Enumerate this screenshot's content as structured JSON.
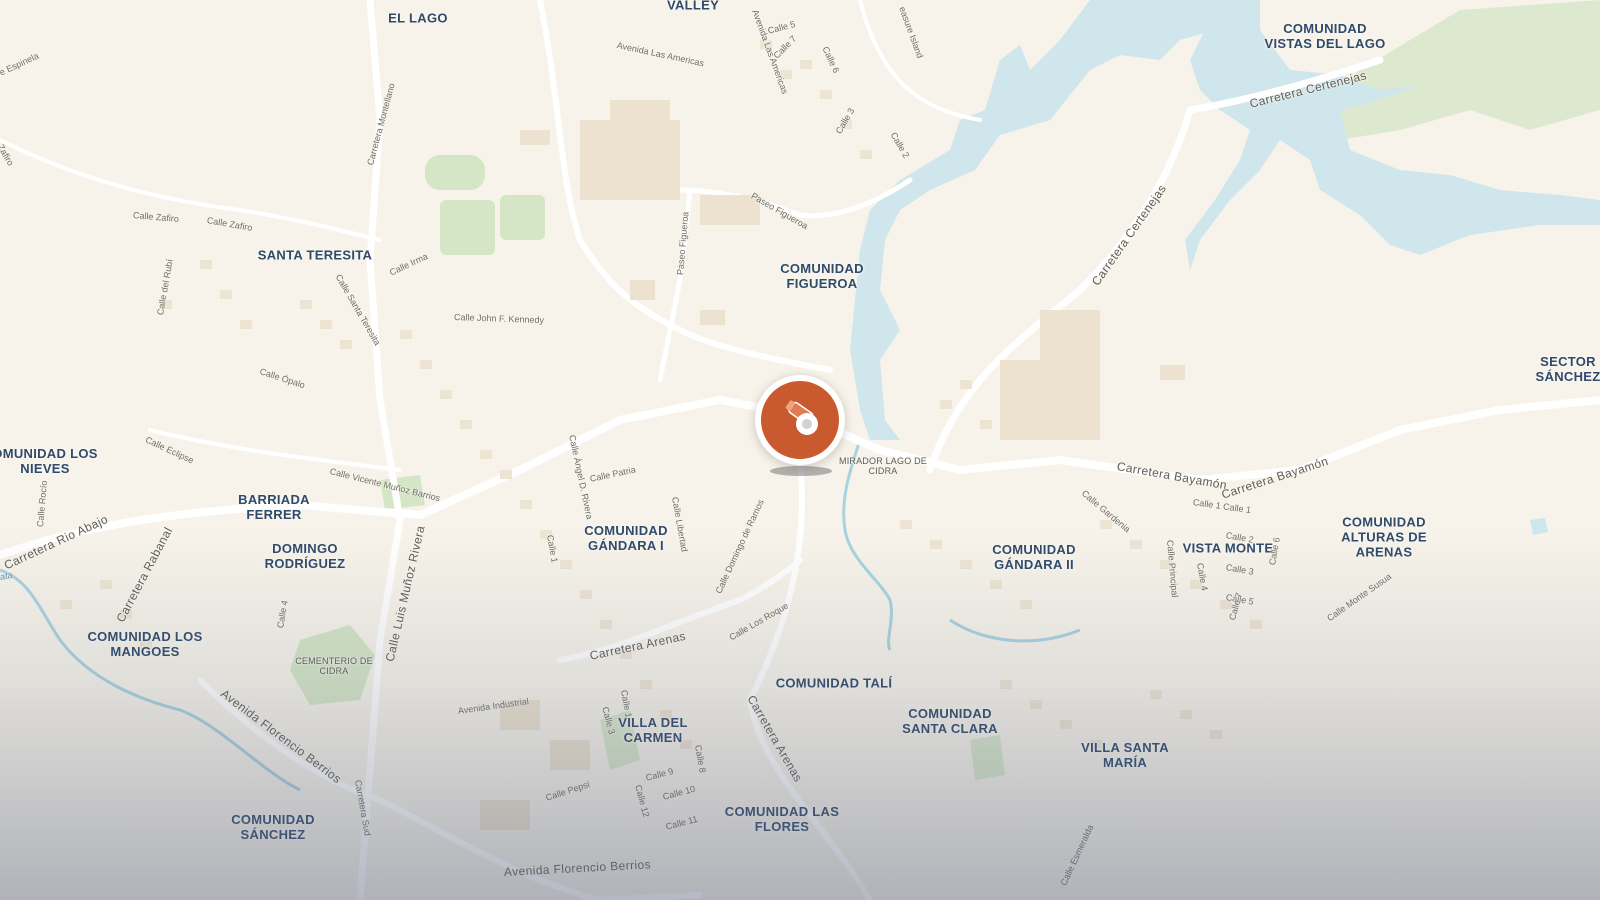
{
  "map": {
    "colors": {
      "land": "#f7f3ea",
      "water": "#cfe6ec",
      "park": "#dbe9cf",
      "road": "#ffffff",
      "building": "#ece2cf",
      "label": "#2f4a6b",
      "marker": "#c9592f"
    },
    "marker": {
      "label": "MIRADOR LAGO DE\nCIDRA",
      "icon": "telescope-icon"
    },
    "area_labels": {
      "el_lago": "EL LAGO",
      "valley": "VALLEY",
      "comunidad_vistas_del_lago": "COMUNIDAD\nVISTAS DEL LAGO",
      "santa_teresita": "SANTA TERESITA",
      "comunidad_figueroa": "COMUNIDAD\nFIGUEROA",
      "sector_sanchez": "SECTOR\nSÁNCHEZ",
      "comunidad_los_nieves": "OMUNIDAD LOS\nNIEVES",
      "barriada_ferrer": "BARRIADA\nFERRER",
      "domingo_rodriguez": "DOMINGO\nRODRÍGUEZ",
      "comunidad_gandara_i": "COMUNIDAD\nGÁNDARA I",
      "comunidad_gandara_ii": "COMUNIDAD\nGÁNDARA II",
      "vista_monte": "VISTA MONTE",
      "comunidad_alturas_de_arenas": "COMUNIDAD\nALTURAS DE\nARENAS",
      "comunidad_los_mangoes": "COMUNIDAD LOS\nMANGOES",
      "comunidad_tali": "COMUNIDAD TALÍ",
      "comunidad_santa_clara": "COMUNIDAD\nSANTA CLARA",
      "villa_del_carmen": "VILLA DEL\nCARMEN",
      "villa_santa_maria": "VILLA SANTA\nMARÍA",
      "comunidad_sanchez": "COMUNIDAD\nSÁNCHEZ",
      "comunidad_las_flores": "COMUNIDAD LAS\nFLORES"
    },
    "poi_labels": {
      "cementerio_de_cidra": "CEMENTERIO DE\nCIDRA"
    },
    "street_labels": {
      "carretera_montellano": "Carretera Montellano",
      "avenida_las_americas": "Avenida Las Americas",
      "avenida_las_americas_2": "Avenida Las Americas",
      "calle_espinela": "e Espinela",
      "zafiro": "Zafiro",
      "calle_zafiro": "Calle Zafiro",
      "calle_zafiro_2": "Calle Zafiro",
      "calle_irma": "Calle Irma",
      "calle_del_rubi": "Calle del Rubí",
      "calle_santa_teresita": "Calle Santa Teresita",
      "calle_john_f_kennedy": "Calle John F. Kennedy",
      "paseo_figueroa": "Paseo Figueroa",
      "paseo_figueroa_2": "Paseo Figueroa",
      "calle_opalo": "Calle Ópalo",
      "calle_eclipse": "Calle Eclipse",
      "calle_vicente_munoz_barrios": "Calle Vicente Muñoz Barrios",
      "calle_rocio": "Calle Rocío",
      "carretera_rio_abajo": "Carretera Rio Abajo",
      "carretera_rabanal": "Carretera Rabanal",
      "calle_luis_munoz_rivera": "Calle Luis Muñoz Rivera",
      "calle_4": "Calle 4",
      "calle_angel_d_rivera": "Calle Ángel D. Rivera",
      "calle_patria": "Calle Patria",
      "calle_libertad": "Calle Libertad",
      "calle_domingo_de_ramos": "Calle Domingo de Ramos",
      "calle_los_roque": "Calle Los Roque",
      "carretera_arenas": "Carretera Arenas",
      "carretera_arenas_2": "Carretera Arenas",
      "avenida_industrial": "Avenida Industrial",
      "avenida_florencio_berrios": "Avenida Florencio Berrios",
      "avenida_florencio_berrios_2": "Avenida Florencio Berrios",
      "carretera_sud": "Carretera Sud",
      "calle_pepsi": "Calle Pepsi",
      "calle_1_a": "Calle 1",
      "calle_1_b": "Calle 1",
      "calle_3": "Calle 3",
      "calle_8": "Calle 8",
      "calle_9": "Calle 9",
      "calle_10": "Calle 10",
      "calle_11": "Calle 11",
      "calle_12": "Calle 12",
      "carretera_certenejas": "Carretera Certenejas",
      "carretera_certenejas_2": "Carretera Certenejas",
      "carretera_bayamon": "Carretera Bayamón",
      "carretera_bayamon_2": "Carretera Bayamón",
      "calle_gardenia": "Calle Gardenia",
      "calle_1_calle_1": "Calle 1 Calle 1",
      "calle_principal": "Calle Principal",
      "calle_2": "Calle 2",
      "calle_3b": "Calle 3",
      "calle_4b": "Calle 4",
      "calle_5": "Calle 5",
      "calle_6": "Calle 6",
      "calle_7": "Calle 7",
      "calle_monte_susua": "Calle Monte Susua",
      "calle_esmeralda": "Calle Esmeralda",
      "calle_5_top": "Calle 5",
      "calle_7_top": "Calle 7",
      "calle_6_top": "Calle 6",
      "calle_3_top": "Calle 3",
      "calle_2_top": "Calle 2",
      "treasure_island": "easure Island",
      "water_label": "ata"
    }
  }
}
